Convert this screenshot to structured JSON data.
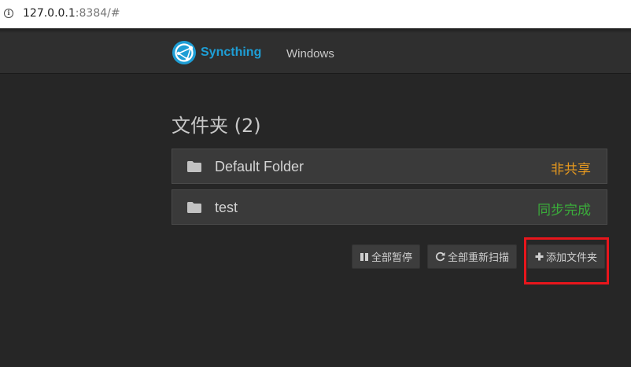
{
  "browser": {
    "url_host": "127.0.0.1",
    "url_rest": ":8384/#"
  },
  "navbar": {
    "brand": "Syncthing",
    "link": "Windows",
    "brand_color": "#1e9ed5"
  },
  "folders": {
    "heading": "文件夹 (2)",
    "items": [
      {
        "name": "Default Folder",
        "status": "非共享",
        "status_color": "#e5981f"
      },
      {
        "name": "test",
        "status": "同步完成",
        "status_color": "#3aac3a"
      }
    ]
  },
  "actions": {
    "pause_all": "全部暂停",
    "rescan_all": "全部重新扫描",
    "add_folder": "添加文件夹"
  },
  "highlight_color": "#e8161c"
}
